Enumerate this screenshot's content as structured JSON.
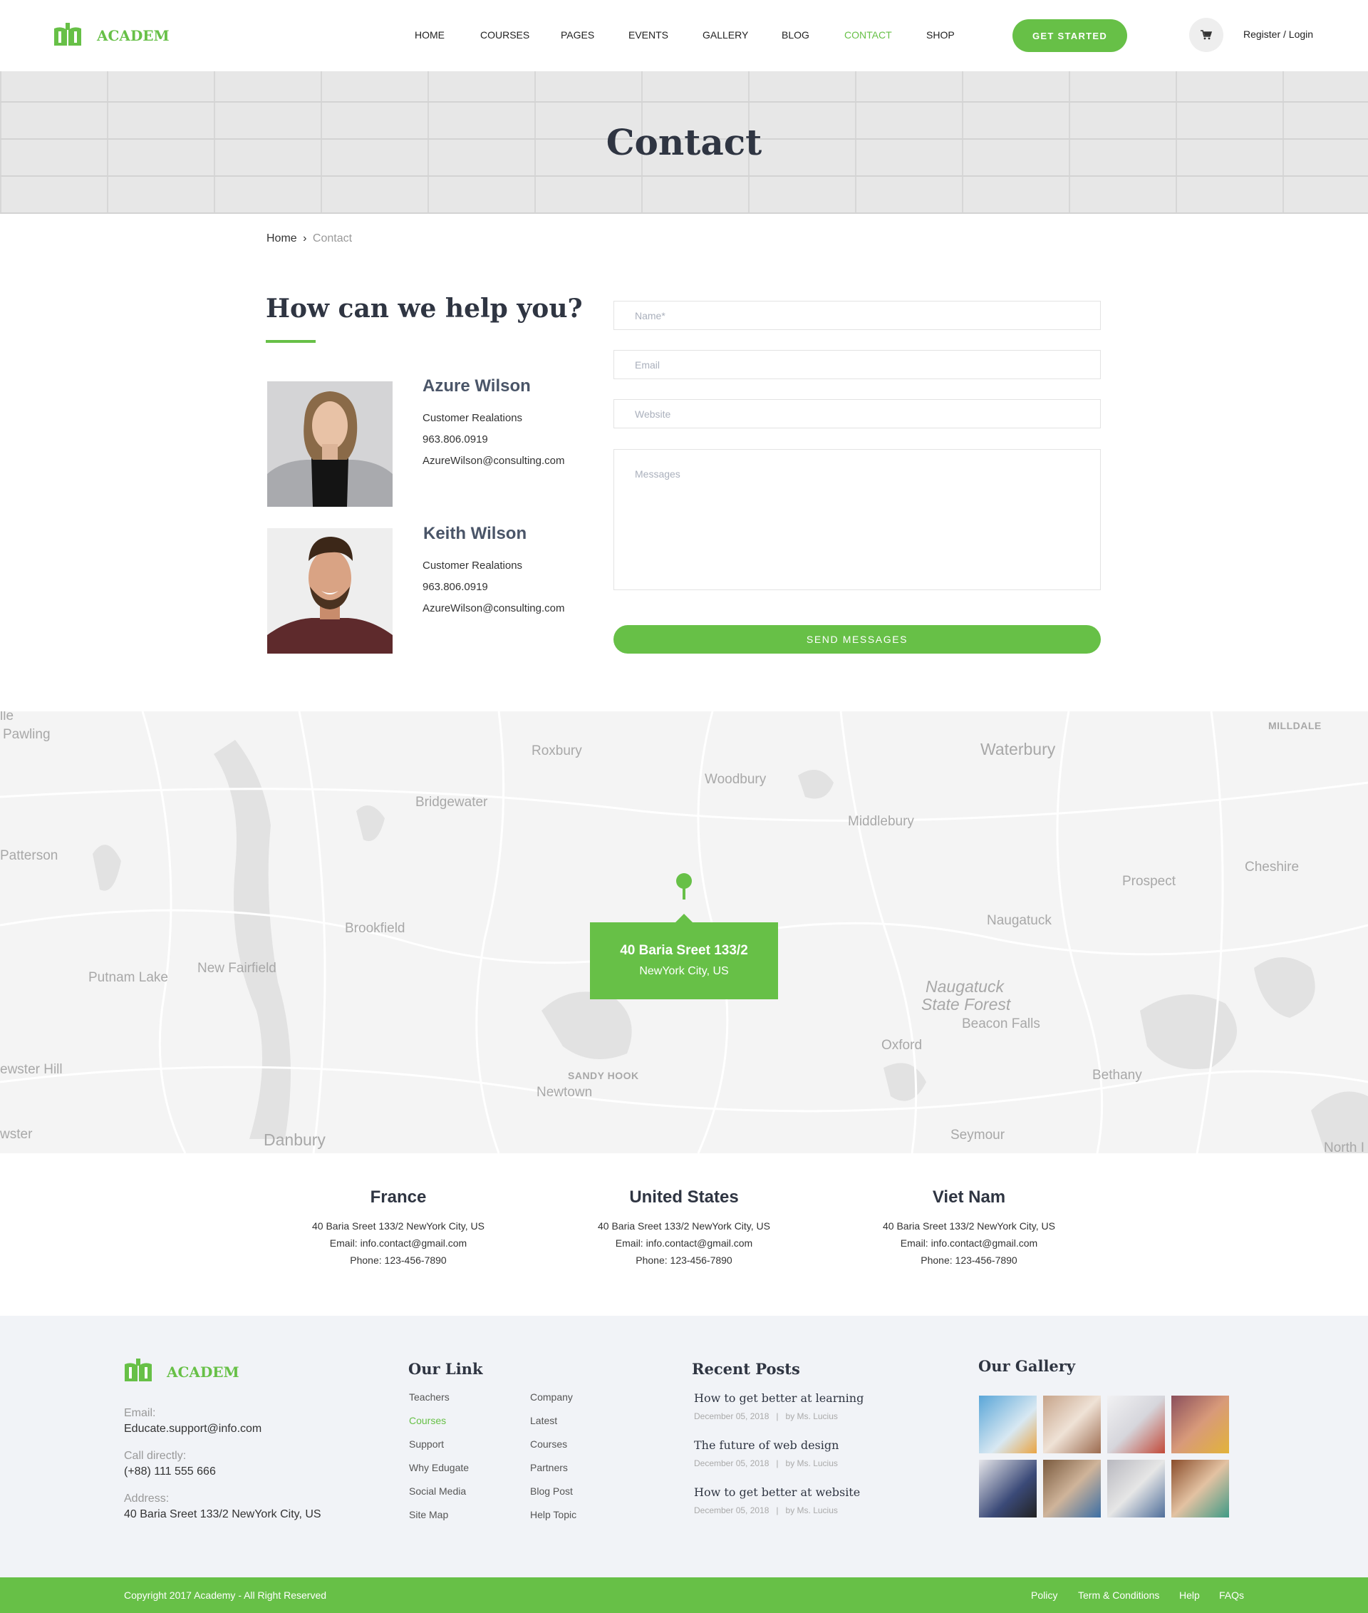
{
  "brand": {
    "name": "ACADEM",
    "color": "#67c047"
  },
  "nav": {
    "items": [
      "HOME",
      "COURSES",
      "PAGES",
      "EVENTS",
      "GALLERY",
      "BLOG",
      "CONTACT",
      "SHOP"
    ],
    "active": "CONTACT",
    "cta": "GET STARTED",
    "cart_icon": "cart-icon",
    "auth": "Register / Login"
  },
  "hero": {
    "title": "Contact"
  },
  "breadcrumb": {
    "home": "Home",
    "separator": "›",
    "current": "Contact"
  },
  "help": {
    "title": "How can we help you?",
    "people": [
      {
        "name": "Azure Wilson",
        "role": "Customer Realations",
        "phone": "963.806.0919",
        "email": "AzureWilson@consulting.com"
      },
      {
        "name": "Keith Wilson",
        "role": "Customer Realations",
        "phone": "963.806.0919",
        "email": "AzureWilson@consulting.com"
      }
    ]
  },
  "form": {
    "name_placeholder": "Name*",
    "email_placeholder": "Email",
    "website_placeholder": "Website",
    "message_placeholder": "Messages",
    "submit": "SEND MESSAGES"
  },
  "map": {
    "labels": [
      "lle",
      "Pawling",
      "Roxbury",
      "Woodbury",
      "Waterbury",
      "MILLDALE",
      "Bridgewater",
      "Middlebury",
      "Patterson",
      "Prospect",
      "Cheshire",
      "Brookfield",
      "Naugatuck",
      "New Fairfield",
      "Putnam Lake",
      "Naugatuck",
      "State Forest",
      "Beacon Falls",
      "Oxford",
      "SANDY HOOK",
      "Newtown",
      "Bethany",
      "ewster Hill",
      "wster",
      "Danbury",
      "Seymour",
      "North I"
    ],
    "card": {
      "address": "40 Baria Sreet 133/2",
      "city": "NewYork City, US"
    }
  },
  "offices": [
    {
      "country": "France",
      "address": "40 Baria Sreet 133/2 NewYork City, US",
      "email": "Email: info.contact@gmail.com",
      "phone": "Phone: 123-456-7890"
    },
    {
      "country": "United States",
      "address": "40 Baria Sreet 133/2 NewYork City, US",
      "email": "Email: info.contact@gmail.com",
      "phone": "Phone: 123-456-7890"
    },
    {
      "country": "Viet Nam",
      "address": "40 Baria Sreet 133/2 NewYork City, US",
      "email": "Email: info.contact@gmail.com",
      "phone": "Phone: 123-456-7890"
    }
  ],
  "footer": {
    "brand": "ACADEM",
    "email_label": "Email:",
    "email": "Educate.support@info.com",
    "call_label": "Call directly:",
    "phone": "(+88) 111 555 666",
    "address_label": "Address:",
    "address": "40 Baria Sreet 133/2 NewYork City, US",
    "links_title": "Our Link",
    "links_col1": [
      "Teachers",
      "Courses",
      "Support",
      "Why Edugate",
      "Social Media",
      "Site Map"
    ],
    "links_col2": [
      "Company",
      "Latest",
      "Courses",
      "Partners",
      "Blog Post",
      "Help Topic"
    ],
    "active_link": "Courses",
    "posts_title": "Recent Posts",
    "posts": [
      {
        "title": "How to get better at learning",
        "meta": "December 05, 2018   |   by Ms. Lucius"
      },
      {
        "title": "The future of web design",
        "meta": "December 05, 2018   |   by Ms. Lucius"
      },
      {
        "title": "How to get better at website",
        "meta": "December 05, 2018   |   by Ms. Lucius"
      }
    ],
    "gallery_title": "Our Gallery"
  },
  "bottom_bar": {
    "copyright": "Copyright 2017 Academy - All Right Reserved",
    "links": [
      "Policy",
      "Term & Conditions",
      "Help",
      "FAQs"
    ]
  }
}
